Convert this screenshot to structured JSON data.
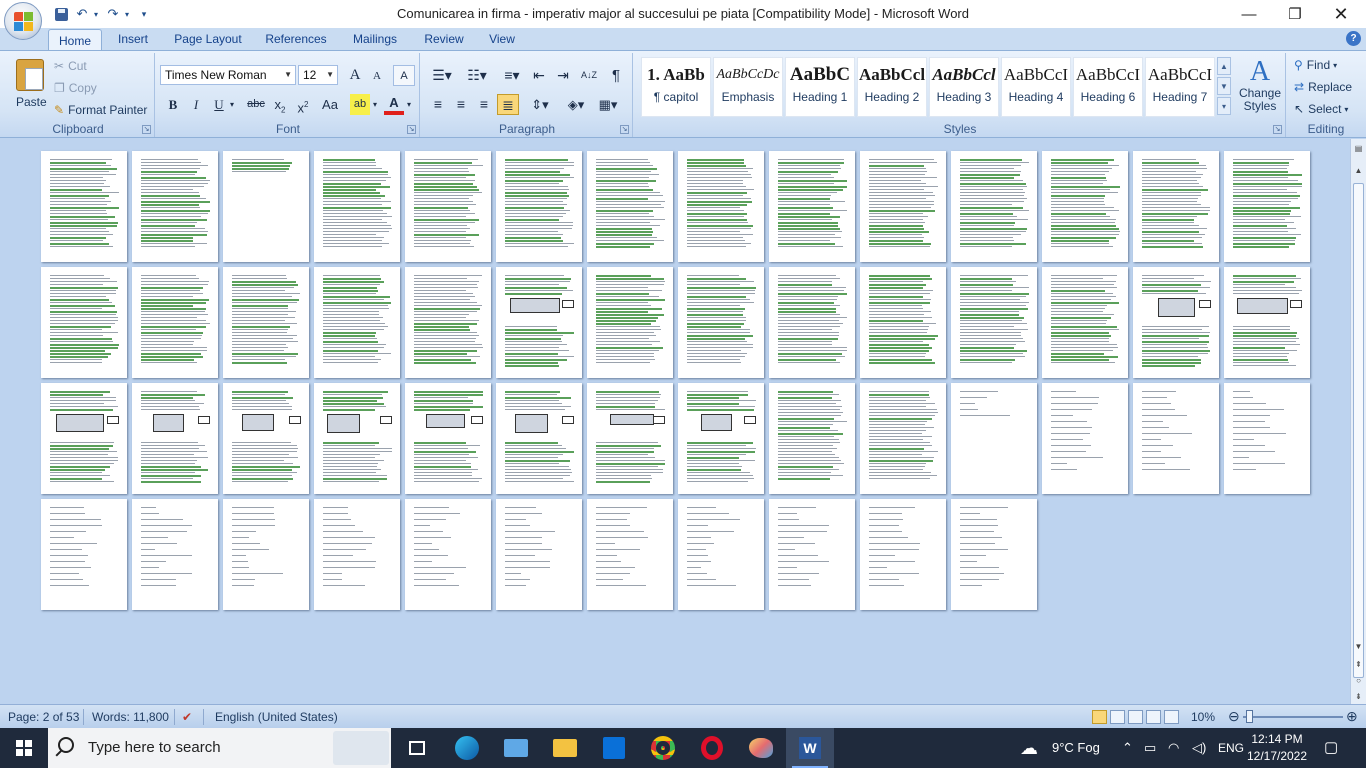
{
  "window": {
    "title": "Comunicarea in firma - imperativ major al succesului pe piata [Compatibility Mode] - Microsoft Word",
    "controls": {
      "minimize": "—",
      "maximize": "❐",
      "close": "✕"
    }
  },
  "qat": {
    "undo_icon": "↶",
    "redo_icon": "↷",
    "dropdown": "▾",
    "customize": "▾"
  },
  "tabs": [
    {
      "label": "Home",
      "active": true
    },
    {
      "label": "Insert"
    },
    {
      "label": "Page Layout"
    },
    {
      "label": "References"
    },
    {
      "label": "Mailings"
    },
    {
      "label": "Review"
    },
    {
      "label": "View"
    }
  ],
  "ribbon": {
    "clipboard": {
      "label": "Clipboard",
      "paste": "Paste",
      "cut": "Cut",
      "copy": "Copy",
      "format_painter": "Format Painter"
    },
    "font": {
      "label": "Font",
      "font_name": "Times New Roman",
      "font_size": "12",
      "grow": "A",
      "shrink": "A",
      "bold": "B",
      "italic": "I",
      "underline": "U",
      "strike": "abc",
      "subscript": "x",
      "superscript": "x",
      "change_case": "Aa",
      "highlight": "ab",
      "font_color": "A"
    },
    "paragraph": {
      "label": "Paragraph",
      "pilcrow": "¶",
      "sort": "A↓Z"
    },
    "styles": {
      "label": "Styles",
      "items": [
        {
          "sample": "1.  AaBb",
          "name": "¶ capitol"
        },
        {
          "sample": "AaBbCcDc",
          "name": "Emphasis"
        },
        {
          "sample": "AaBbC",
          "name": "Heading 1"
        },
        {
          "sample": "AaBbCcl",
          "name": "Heading 2"
        },
        {
          "sample": "AaBbCcl",
          "name": "Heading 3"
        },
        {
          "sample": "AaBbCcI",
          "name": "Heading 4"
        },
        {
          "sample": "AaBbCcI",
          "name": "Heading 6"
        },
        {
          "sample": "AaBbCcI",
          "name": "Heading 7"
        }
      ],
      "change_styles": "Change",
      "change_styles_2": "Styles"
    },
    "editing": {
      "label": "Editing",
      "find": "Find",
      "replace": "Replace",
      "select": "Select"
    }
  },
  "document": {
    "page_count": 53,
    "rows": 4,
    "columns": 14,
    "last_row_pages": 11
  },
  "status": {
    "page": "Page: 2 of 53",
    "words": "Words: 11,800",
    "language": "English (United States)",
    "zoom": "10%"
  },
  "taskbar": {
    "search_placeholder": "Type here to search",
    "weather": "9°C  Fog",
    "language": "ENG",
    "time": "12:14 PM",
    "date": "12/17/2022"
  },
  "colors": {
    "ribbon_bg": "#d5e4f5",
    "doc_bg": "#bdd3ef",
    "taskbar": "#1f2a3c",
    "accent": "#15428b"
  }
}
